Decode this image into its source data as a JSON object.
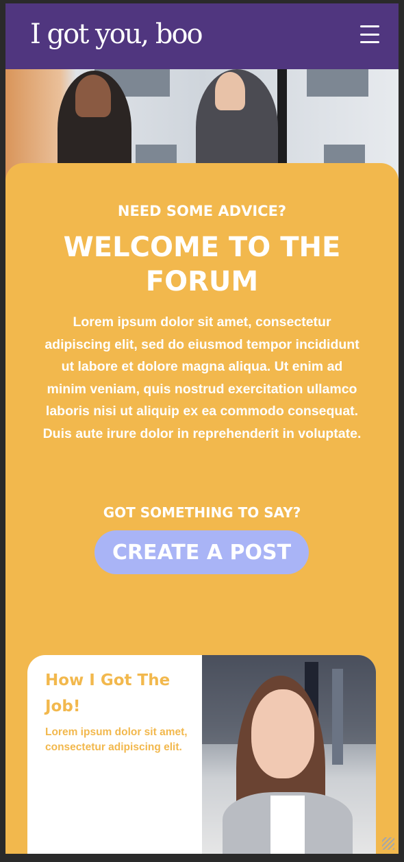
{
  "header": {
    "logo": "I got you, boo",
    "menu_icon": "hamburger-menu-icon"
  },
  "hero": {
    "eyebrow": "NEED SOME ADVICE?",
    "title": "WELCOME TO THE FORUM",
    "body": "Lorem ipsum dolor sit amet, consectetur adipiscing elit, sed do eiusmod tempor incididunt ut labore et dolore magna aliqua. Ut enim ad minim veniam, quis nostrud exercitation ullamco laboris nisi ut aliquip ex ea commodo consequat. Duis aute irure dolor in reprehenderit in voluptate."
  },
  "cta": {
    "label": "GOT SOMETHING TO SAY?",
    "button": "CREATE A POST"
  },
  "card": {
    "title": "How I Got The Job!",
    "text": "Lorem ipsum dolor sit amet, consectetur adipiscing elit."
  },
  "colors": {
    "header_bg": "#50367f",
    "panel_bg": "#f2b84d",
    "button_bg": "#a9b4f6",
    "text_on_accent": "#ffffff"
  }
}
